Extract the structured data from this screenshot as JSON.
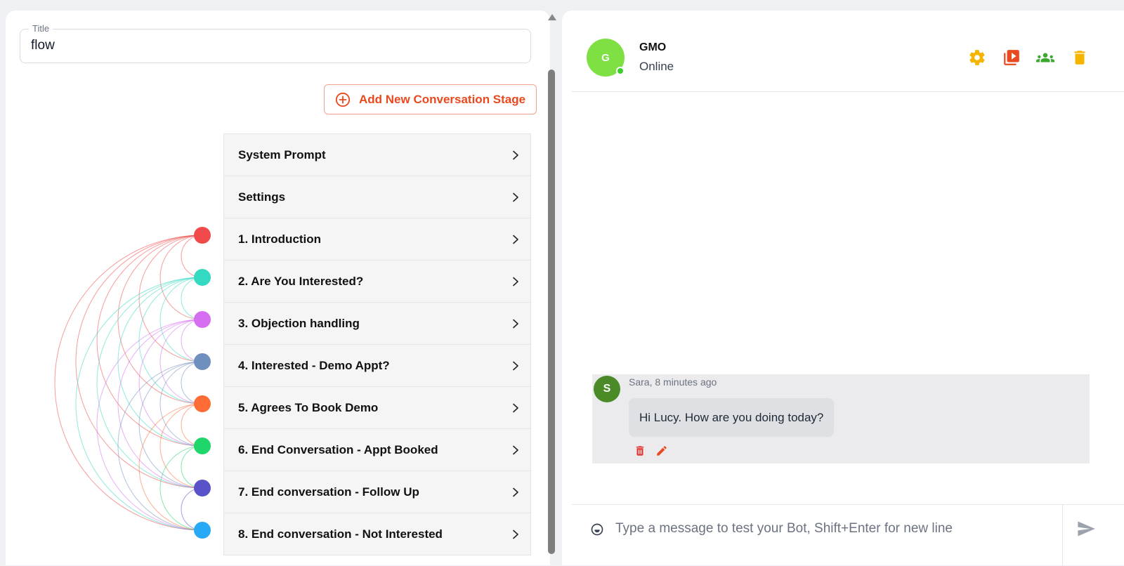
{
  "editor": {
    "title_label": "Title",
    "title_value": "flow",
    "add_stage_label": "Add New Conversation Stage",
    "stages": [
      {
        "label": "System Prompt"
      },
      {
        "label": "Settings"
      },
      {
        "label": "1. Introduction",
        "color": "#f04a4a"
      },
      {
        "label": "2. Are You Interested?",
        "color": "#33d9c0"
      },
      {
        "label": "3. Objection handling",
        "color": "#d56ef0"
      },
      {
        "label": "4. Interested - Demo Appt?",
        "color": "#6f8fbf"
      },
      {
        "label": "5. Agrees To Book Demo",
        "color": "#ff6b35"
      },
      {
        "label": "6. End Conversation - Appt Booked",
        "color": "#1fd66a"
      },
      {
        "label": "7. End conversation - Follow Up",
        "color": "#5a52c9"
      },
      {
        "label": "8. End conversation - Not Interested",
        "color": "#28a9f5"
      }
    ]
  },
  "chat": {
    "avatar_initial": "G",
    "bot_name": "GMO",
    "bot_status": "Online",
    "header_icons": [
      {
        "name": "settings-gear-icon",
        "color": "#f5b400"
      },
      {
        "name": "video-playlist-icon",
        "color": "#e8491e"
      },
      {
        "name": "group-icon",
        "color": "#3aa82a"
      },
      {
        "name": "trash-icon",
        "color": "#f5b400"
      }
    ],
    "message": {
      "avatar_initial": "S",
      "meta": "Sara, 8 minutes ago",
      "text": "Hi Lucy. How are you doing today?"
    },
    "composer_placeholder": "Type a message to test your Bot, Shift+Enter for new line"
  }
}
